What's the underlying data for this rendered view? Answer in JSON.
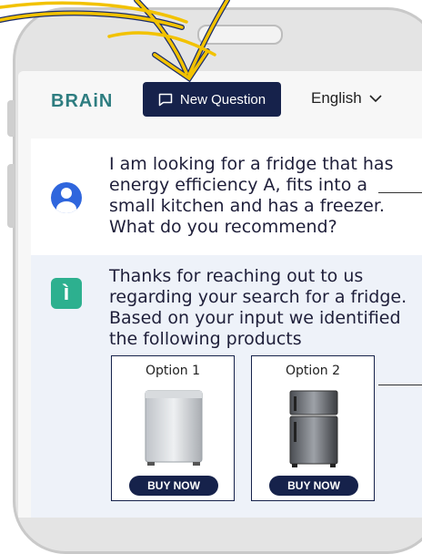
{
  "header": {
    "logo": "BRAiN",
    "new_question_label": "New Question",
    "language_label": "English"
  },
  "chat": {
    "user_message": "I am looking for a fridge that has energy efficiency A, fits into a small kitchen and has a freezer. What do you recommend?",
    "bot_message": "Thanks for reaching out to us regarding your search for a fridge. Based on your input we identified the following products"
  },
  "products": [
    {
      "option_label": "Option 1",
      "buy_label": "BUY NOW",
      "type": "mini fridge"
    },
    {
      "option_label": "Option 2",
      "buy_label": "BUY NOW",
      "type": "top-freezer fridge"
    }
  ],
  "colors": {
    "brand_navy": "#16224b",
    "logo_teal": "#2e7d80",
    "user_avatar": "#2f66dd",
    "bot_avatar": "#2db08f",
    "highlight_arrow": "#f2c200"
  },
  "icons": [
    "message-square-icon",
    "chevron-down-icon",
    "user-avatar-icon",
    "bot-info-icon",
    "highlight-arrow"
  ]
}
